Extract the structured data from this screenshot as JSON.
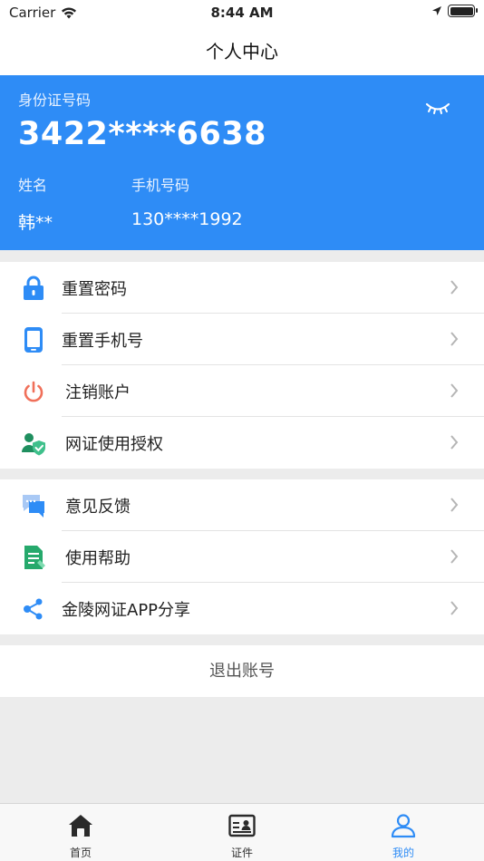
{
  "status_bar": {
    "carrier": "Carrier",
    "time": "8:44 AM"
  },
  "nav": {
    "title": "个人中心"
  },
  "card": {
    "id_label": "身份证号码",
    "id_number": "3422****6638",
    "name_label": "姓名",
    "name_value": "韩**",
    "phone_label": "手机号码",
    "phone_value": "130****1992"
  },
  "menu_group_1": [
    {
      "label": "重置密码",
      "icon": "lock-icon"
    },
    {
      "label": "重置手机号",
      "icon": "phone-icon"
    },
    {
      "label": "注销账户",
      "icon": "power-icon"
    },
    {
      "label": "网证使用授权",
      "icon": "user-shield-icon"
    }
  ],
  "menu_group_2": [
    {
      "label": "意见反馈",
      "icon": "chat-icon"
    },
    {
      "label": "使用帮助",
      "icon": "document-icon"
    },
    {
      "label": "金陵网证APP分享",
      "icon": "share-icon"
    }
  ],
  "logout_label": "退出账号",
  "tabs": [
    {
      "label": "首页",
      "icon": "home-icon"
    },
    {
      "label": "证件",
      "icon": "id-card-icon"
    },
    {
      "label": "我的",
      "icon": "person-icon",
      "active": true
    }
  ],
  "colors": {
    "accent": "#2e8cf6",
    "danger": "#f0705a",
    "green": "#26a96c"
  }
}
